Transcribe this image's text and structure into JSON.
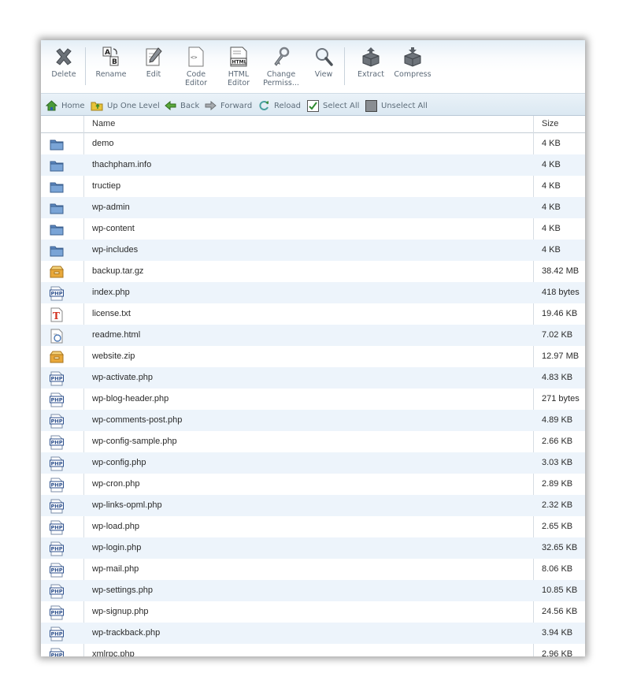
{
  "toolbar": {
    "delete": "Delete",
    "rename": "Rename",
    "edit": "Edit",
    "code_editor_1": "Code",
    "code_editor_2": "Editor",
    "html_editor_1": "HTML",
    "html_editor_2": "Editor",
    "change_perm_1": "Change",
    "change_perm_2": "Permiss...",
    "view": "View",
    "extract": "Extract",
    "compress": "Compress",
    "html_icon_text": "HTML"
  },
  "nav": {
    "home": "Home",
    "up": "Up One Level",
    "back": "Back",
    "forward": "Forward",
    "reload": "Reload",
    "select_all": "Select All",
    "unselect_all": "Unselect All"
  },
  "columns": {
    "name": "Name",
    "size": "Size"
  },
  "files": [
    {
      "name": "demo",
      "size": "4 KB",
      "icon": "folder-icon"
    },
    {
      "name": "thachpham.info",
      "size": "4 KB",
      "icon": "folder-icon"
    },
    {
      "name": "tructiep",
      "size": "4 KB",
      "icon": "folder-icon"
    },
    {
      "name": "wp-admin",
      "size": "4 KB",
      "icon": "folder-icon"
    },
    {
      "name": "wp-content",
      "size": "4 KB",
      "icon": "folder-icon"
    },
    {
      "name": "wp-includes",
      "size": "4 KB",
      "icon": "folder-icon"
    },
    {
      "name": "backup.tar.gz",
      "size": "38.42 MB",
      "icon": "archive-icon"
    },
    {
      "name": "index.php",
      "size": "418 bytes",
      "icon": "php-file-icon"
    },
    {
      "name": "license.txt",
      "size": "19.46 KB",
      "icon": "text-file-icon"
    },
    {
      "name": "readme.html",
      "size": "7.02 KB",
      "icon": "html-file-icon"
    },
    {
      "name": "website.zip",
      "size": "12.97 MB",
      "icon": "archive-icon"
    },
    {
      "name": "wp-activate.php",
      "size": "4.83 KB",
      "icon": "php-file-icon"
    },
    {
      "name": "wp-blog-header.php",
      "size": "271 bytes",
      "icon": "php-file-icon"
    },
    {
      "name": "wp-comments-post.php",
      "size": "4.89 KB",
      "icon": "php-file-icon"
    },
    {
      "name": "wp-config-sample.php",
      "size": "2.66 KB",
      "icon": "php-file-icon"
    },
    {
      "name": "wp-config.php",
      "size": "3.03 KB",
      "icon": "php-file-icon"
    },
    {
      "name": "wp-cron.php",
      "size": "2.89 KB",
      "icon": "php-file-icon"
    },
    {
      "name": "wp-links-opml.php",
      "size": "2.32 KB",
      "icon": "php-file-icon"
    },
    {
      "name": "wp-load.php",
      "size": "2.65 KB",
      "icon": "php-file-icon"
    },
    {
      "name": "wp-login.php",
      "size": "32.65 KB",
      "icon": "php-file-icon"
    },
    {
      "name": "wp-mail.php",
      "size": "8.06 KB",
      "icon": "php-file-icon"
    },
    {
      "name": "wp-settings.php",
      "size": "10.85 KB",
      "icon": "php-file-icon"
    },
    {
      "name": "wp-signup.php",
      "size": "24.56 KB",
      "icon": "php-file-icon"
    },
    {
      "name": "wp-trackback.php",
      "size": "3.94 KB",
      "icon": "php-file-icon"
    },
    {
      "name": "xmlrpc.php",
      "size": "2.96 KB",
      "icon": "php-file-icon"
    }
  ],
  "php_icon_text": "PHP",
  "text_icon_text": "T",
  "colors": {
    "row_alt": "#edf4fb",
    "toolbar_top": "#e3eef6",
    "navbar": "#dbe8f2",
    "folder": "#5b87bf"
  }
}
